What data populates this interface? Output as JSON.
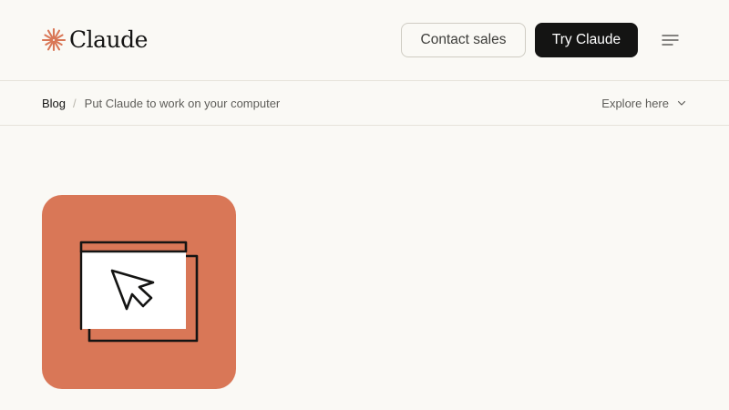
{
  "header": {
    "logo_text": "Claude",
    "logo_icon": "claude-starburst-icon",
    "contact_sales_label": "Contact sales",
    "try_claude_label": "Try Claude",
    "menu_icon": "menu-icon"
  },
  "breadcrumb": {
    "parent_label": "Blog",
    "separator": "/",
    "current_label": "Put Claude to work on your computer"
  },
  "explore": {
    "label": "Explore here",
    "icon": "chevron-down-icon"
  },
  "hero": {
    "illustration_icon": "computer-window-cursor-icon"
  },
  "colors": {
    "background": "#faf9f5",
    "brand_accent": "#d97757",
    "primary_button": "#141413",
    "divider": "#e6e3da"
  }
}
